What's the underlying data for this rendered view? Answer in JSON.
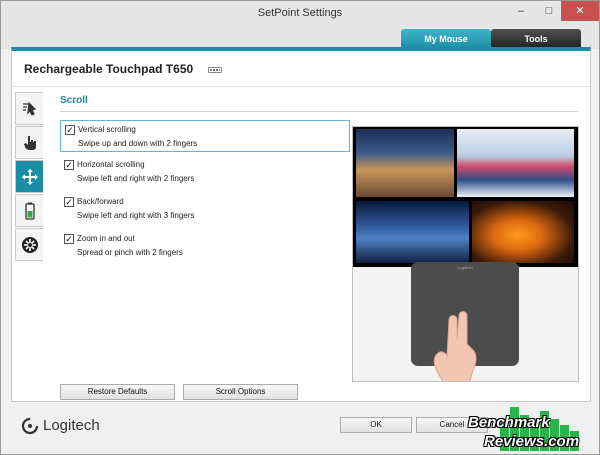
{
  "window": {
    "title": "SetPoint Settings",
    "minimize": "–",
    "maximize": "□",
    "close": "✕"
  },
  "tabs": [
    {
      "label": "My Mouse"
    },
    {
      "label": "Tools"
    }
  ],
  "device": {
    "name": "Rechargeable Touchpad T650"
  },
  "sidebar": {
    "items": [
      {
        "icon": "pointer-icon"
      },
      {
        "icon": "hand-pointer-icon"
      },
      {
        "icon": "move-arrows-icon"
      },
      {
        "icon": "battery-icon"
      },
      {
        "icon": "gear-icon"
      }
    ]
  },
  "section": {
    "title": "Scroll"
  },
  "options": [
    {
      "label": "Vertical scrolling",
      "desc": "Swipe up and down with 2 fingers",
      "checked": true
    },
    {
      "label": "Horizontal scrolling",
      "desc": "Swipe left and right with 2 fingers",
      "checked": true
    },
    {
      "label": "Back/forward",
      "desc": "Swipe left and right with 3 fingers",
      "checked": true
    },
    {
      "label": "Zoom in and out",
      "desc": "Spread or pinch with 2 fingers",
      "checked": true
    }
  ],
  "buttons": {
    "restore": "Restore Defaults",
    "scroll_options": "Scroll Options",
    "ok": "OK",
    "cancel": "Cancel"
  },
  "footer": {
    "logo": "Logitech"
  },
  "preview": {
    "pad_brand": "Logitech"
  },
  "watermark": {
    "line1": "Benchmark",
    "line2": "Reviews.com"
  },
  "colors": {
    "accent": "#1b8ea5",
    "tab_dark": "#202020"
  }
}
